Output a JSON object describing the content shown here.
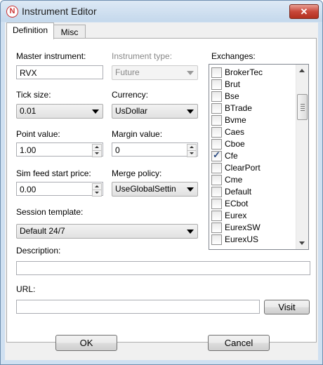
{
  "window": {
    "title": "Instrument Editor",
    "close_label": "✕"
  },
  "tabs": [
    {
      "label": "Definition"
    },
    {
      "label": "Misc"
    }
  ],
  "fields": {
    "master_instrument": {
      "label": "Master instrument:",
      "value": "RVX"
    },
    "instrument_type": {
      "label": "Instrument type:",
      "value": "Future"
    },
    "tick_size": {
      "label": "Tick size:",
      "value": "0.01"
    },
    "currency": {
      "label": "Currency:",
      "value": "UsDollar"
    },
    "point_value": {
      "label": "Point value:",
      "value": "1.00"
    },
    "margin_value": {
      "label": "Margin value:",
      "value": "0"
    },
    "sim_feed_start_price": {
      "label": "Sim feed start price:",
      "value": "0.00"
    },
    "merge_policy": {
      "label": "Merge policy:",
      "value": "UseGlobalSettin"
    },
    "session_template": {
      "label": "Session template:",
      "value": "Default 24/7"
    },
    "description": {
      "label": "Description:",
      "value": ""
    },
    "url": {
      "label": "URL:",
      "value": ""
    }
  },
  "exchanges": {
    "label": "Exchanges:",
    "items": [
      {
        "label": "BrokerTec",
        "checked": false
      },
      {
        "label": "Brut",
        "checked": false
      },
      {
        "label": "Bse",
        "checked": false
      },
      {
        "label": "BTrade",
        "checked": false
      },
      {
        "label": "Bvme",
        "checked": false
      },
      {
        "label": "Caes",
        "checked": false
      },
      {
        "label": "Cboe",
        "checked": false
      },
      {
        "label": "Cfe",
        "checked": true
      },
      {
        "label": "ClearPort",
        "checked": false
      },
      {
        "label": "Cme",
        "checked": false
      },
      {
        "label": "Default",
        "checked": false
      },
      {
        "label": "ECbot",
        "checked": false
      },
      {
        "label": "Eurex",
        "checked": false
      },
      {
        "label": "EurexSW",
        "checked": false
      },
      {
        "label": "EurexUS",
        "checked": false
      }
    ]
  },
  "buttons": {
    "visit": "Visit",
    "ok": "OK",
    "cancel": "Cancel"
  },
  "colors": {
    "title_bar": "#c4d8ec",
    "close_button": "#c8473a",
    "check_mark": "#2a4a80"
  }
}
